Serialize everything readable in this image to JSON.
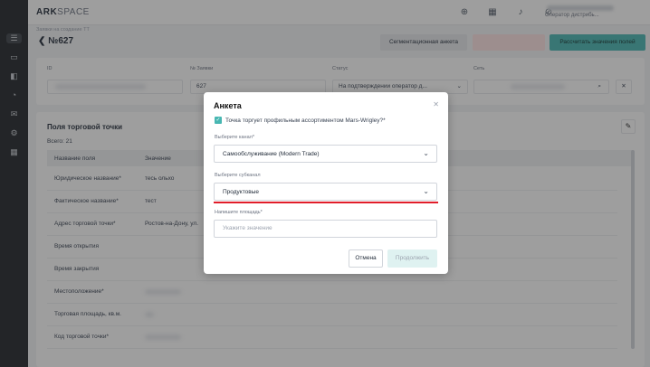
{
  "app": {
    "logo_main": "ARK",
    "logo_sub": "SPACE"
  },
  "sidebar": {
    "icons": [
      "list-icon",
      "storage-icon",
      "box-icon",
      "routes-icon",
      "mail-icon",
      "settings-icon",
      "calendar-icon"
    ]
  },
  "topbar": {
    "user_role": "Оператор дистрибь..."
  },
  "header": {
    "breadcrumb": "Заявки на создание ТТ",
    "title": "№627",
    "seg_button": "Сегментационная анкета",
    "calc_button": "Рассчитать значения полей"
  },
  "info": {
    "id_label": "ID",
    "req_label": "№ Заявки",
    "req_value": "627",
    "status_label": "Статус",
    "status_value": "На подтверждении оператор д...",
    "net_label": "Сеть"
  },
  "card": {
    "title": "Поля торговой точки",
    "total": "Всего: 21",
    "col_field": "Название поля",
    "col_value": "Значение",
    "rows": [
      {
        "k": "Юридическое название*",
        "v": "тесь ольхо"
      },
      {
        "k": "Фактическое название*",
        "v": "тест"
      },
      {
        "k": "Адрес торговой точки*",
        "v": "Ростов-на-Дону, ул."
      },
      {
        "k": "Время открытия",
        "v": ""
      },
      {
        "k": "Время закрытия",
        "v": ""
      },
      {
        "k": "Местоположение*",
        "v": ""
      },
      {
        "k": "Торговая площадь, кв.м.",
        "v": ""
      },
      {
        "k": "Код торговой точки*",
        "v": ""
      }
    ]
  },
  "modal": {
    "title": "Анкета",
    "checkbox_label": "Точка торгует профильным ассортиментом Mars-Wrigley?*",
    "channel_label": "Выберите канал*",
    "channel_value": "Самообслуживание (Modern Trade)",
    "subchannel_label": "Выберите субканал",
    "subchannel_value": "Продуктовые",
    "area_label": "Напишите площадь*",
    "area_placeholder": "Укажите значение",
    "cancel": "Отмена",
    "continue": "Продолжить"
  },
  "colors": {
    "accent": "#48b7b2",
    "highlight": "#e11d2a",
    "sidebar": "#1f2328"
  }
}
